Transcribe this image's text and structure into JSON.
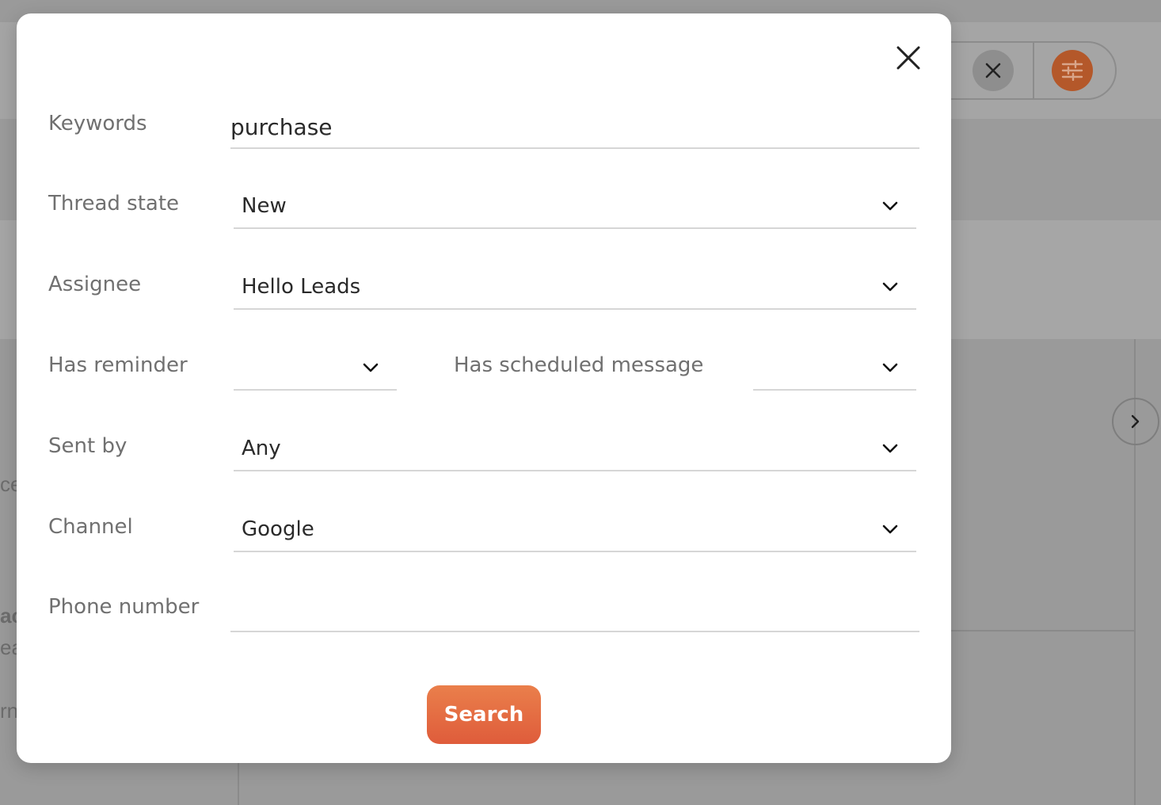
{
  "colors": {
    "accent": "#e46a40",
    "overlay": "#9a9a9a",
    "label_text": "#707070",
    "value_text": "#2a2a2a",
    "underline": "#d6d6d6"
  },
  "background": {
    "clear_icon": "close-icon",
    "filter_icon": "sliders-icon",
    "next_icon": "chevron-right-icon",
    "fragments": [
      "ce",
      "ac",
      "ea",
      "rn"
    ]
  },
  "modal": {
    "close_icon": "close-icon",
    "fields": {
      "keywords": {
        "label": "Keywords",
        "value": "purchase"
      },
      "thread_state": {
        "label": "Thread state",
        "value": "New"
      },
      "assignee": {
        "label": "Assignee",
        "value": "Hello Leads"
      },
      "has_reminder": {
        "label": "Has reminder",
        "value": ""
      },
      "has_scheduled_message": {
        "label": "Has scheduled message",
        "value": ""
      },
      "sent_by": {
        "label": "Sent by",
        "value": "Any"
      },
      "channel": {
        "label": "Channel",
        "value": "Google"
      },
      "phone_number": {
        "label": "Phone number",
        "value": ""
      }
    },
    "dropdown_icon": "chevron-down-icon",
    "search_button": "Search"
  }
}
